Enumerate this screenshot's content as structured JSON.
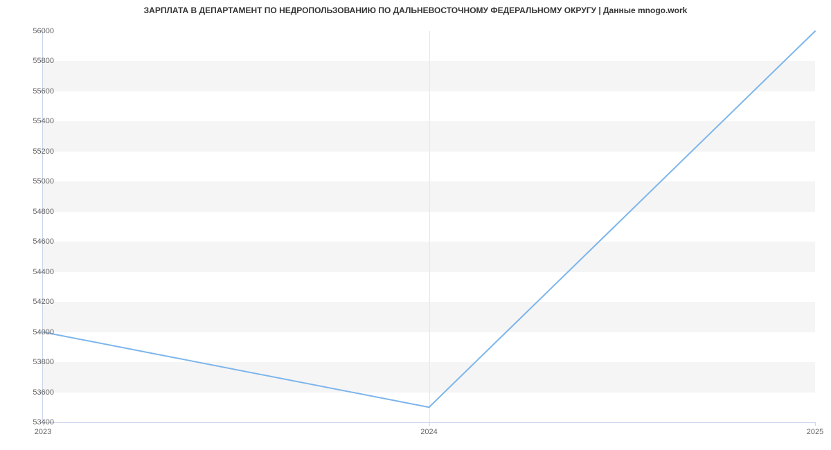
{
  "title": "ЗАРПЛАТА В ДЕПАРТАМЕНТ ПО НЕДРОПОЛЬЗОВАНИЮ ПО ДАЛЬНЕВОСТОЧНОМУ ФЕДЕРАЛЬНОМУ ОКРУГУ | Данные mnogo.work",
  "chart_data": {
    "type": "line",
    "x": [
      2023,
      2024,
      2025
    ],
    "values": [
      54000,
      53500,
      56000
    ],
    "xlabel": "",
    "ylabel": "",
    "ylim": [
      53400,
      56000
    ],
    "y_ticks": [
      53400,
      53600,
      53800,
      54000,
      54200,
      54400,
      54600,
      54800,
      55000,
      55200,
      55400,
      55600,
      55800,
      56000
    ],
    "x_ticks": [
      2023,
      2024,
      2025
    ],
    "line_color": "#7cb5ec"
  },
  "y_labels": {
    "t0": "53400",
    "t1": "53600",
    "t2": "53800",
    "t3": "54000",
    "t4": "54200",
    "t5": "54400",
    "t6": "54600",
    "t7": "54800",
    "t8": "55000",
    "t9": "55200",
    "t10": "55400",
    "t11": "55600",
    "t12": "55800",
    "t13": "56000"
  },
  "x_labels": {
    "x0": "2023",
    "x1": "2024",
    "x2": "2025"
  }
}
